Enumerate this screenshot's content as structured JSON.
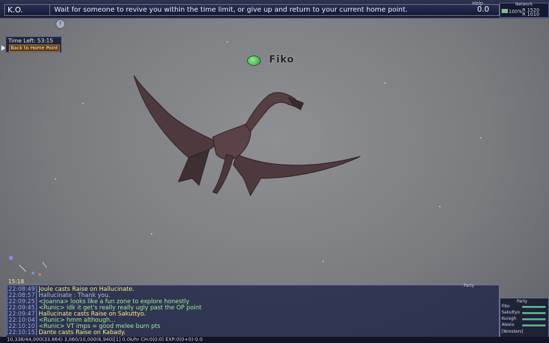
{
  "top_bar": {
    "status_label": "K.O.",
    "message": "Wait for someone to revive you within the time limit, or give up and return to your current home point.",
    "help_label": "Help",
    "help_value": "0.0",
    "network": {
      "label": "Network",
      "percent": "100%",
      "r1": "R 1520",
      "r2": "R 1010"
    }
  },
  "timer": {
    "time_left": "Time Left:  53:15",
    "home_button": "Back to Home Point"
  },
  "target": {
    "name": "Fiko",
    "icon": "green-orb-icon"
  },
  "clock": "15:18",
  "chat": {
    "tab_label": "Party",
    "lines": [
      {
        "ts": "[22:08:49]",
        "text": "Joule casts Raise on Hallucinate."
      },
      {
        "ts": "[22:08:57]",
        "text": "Hallucinate : Thank you."
      },
      {
        "ts": "[22:09:25]",
        "text": "<Joanna> looks like a fun zone to explore honestly"
      },
      {
        "ts": "[22:09:45]",
        "text": "<Runic> idk it get's really really ugly past the OP point"
      },
      {
        "ts": "[22:09:47]",
        "text": "Hallucinate casts Raise on Sakuttyo."
      },
      {
        "ts": "[22:10:04]",
        "text": "<Runic> hmm although..."
      },
      {
        "ts": "[22:10:10]",
        "text": "<Runic> VT imps = good melee burn pts"
      },
      {
        "ts": "[22:10:15]",
        "text": "Dante casts Raise on Kabady."
      }
    ]
  },
  "status_bar": "10,336/44,000(33,664)  3,060/10,000(6,940)[1]  0.0k/hr  CH:0(0:0)  EXP:0(0+0)-0.0",
  "party": {
    "label": "Party",
    "members": [
      {
        "name": "Fiko"
      },
      {
        "name": "Sakuttyo"
      },
      {
        "name": "Kuragh"
      },
      {
        "name": "Alexio"
      }
    ],
    "footer": "[Nimsters]"
  },
  "colors": {
    "panel_bg": "#1a1f35",
    "panel_border": "#6b7398",
    "chat_yellow": "#f5f08c",
    "chat_green": "#9ff09b",
    "timestamp": "#9aa8ff"
  }
}
